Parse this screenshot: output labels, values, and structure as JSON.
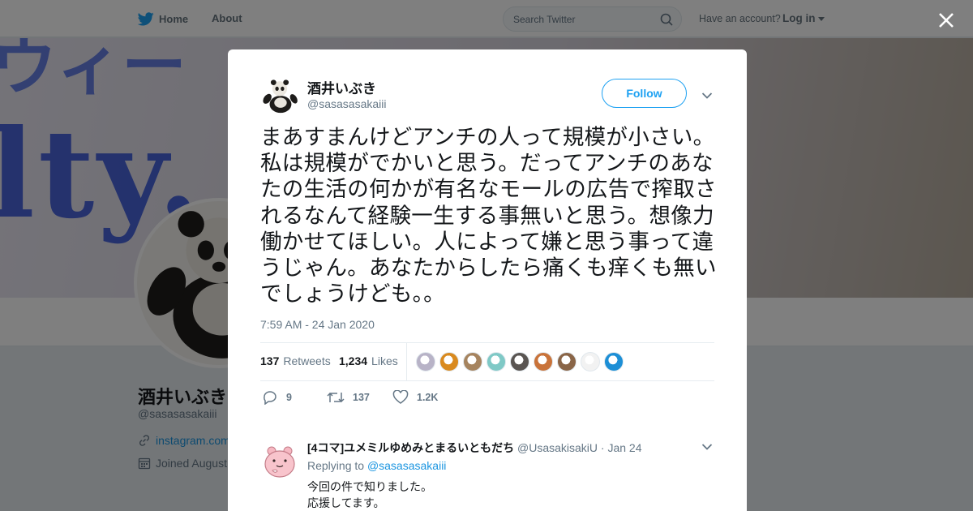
{
  "nav": {
    "home_label": "Home",
    "about_label": "About",
    "search_placeholder": "Search Twitter",
    "have_account": "Have an account?",
    "login_label": "Log in"
  },
  "profile": {
    "name": "酒井いぶき",
    "handle": "@sasasasakaiii",
    "link": "instagram.com",
    "joined": "Joined August"
  },
  "tweet": {
    "author_name": "酒井いぶき",
    "author_handle": "@sasasasakaiii",
    "follow_label": "Follow",
    "text": "まあすまんけどアンチの人って規模が小さい。私は規模がでかいと思う。だってアンチのあなたの生活の何かが有名なモールの広告で搾取されるなんて経験一生する事無いと思う。想像力働かせてほしい。人によって嫌と思う事って違うじゃん。あなたからしたら痛くも痒くも無いでしょうけども。。",
    "timestamp": "7:59 AM - 24 Jan 2020",
    "retweets_count": "137",
    "retweets_label": "Retweets",
    "likes_count": "1,234",
    "likes_label": "Likes",
    "likers_colors": [
      "#b8b3c7",
      "#d98a1f",
      "#a6845f",
      "#7fc9c6",
      "#5a5552",
      "#c9733a",
      "#8a6547",
      "#f2f2f2",
      "#1d8fd6"
    ],
    "reply_count": "9",
    "retweet_action_count": "137",
    "like_action_count": "1.2K"
  },
  "reply": {
    "name": "[4コマ]ユメミルゆめみとまるいともだち",
    "handle": "@UsasakisakiU",
    "dot": "·",
    "date": "Jan 24",
    "replying_to_label": "Replying to",
    "replying_to_mention": "@sasasasakaiii",
    "line1": "今回の件で知りました。",
    "line2": "応援してます。"
  },
  "colors": {
    "twitter_blue": "#1da1f2",
    "link_blue": "#1b95e0",
    "secondary_text": "#657786"
  }
}
